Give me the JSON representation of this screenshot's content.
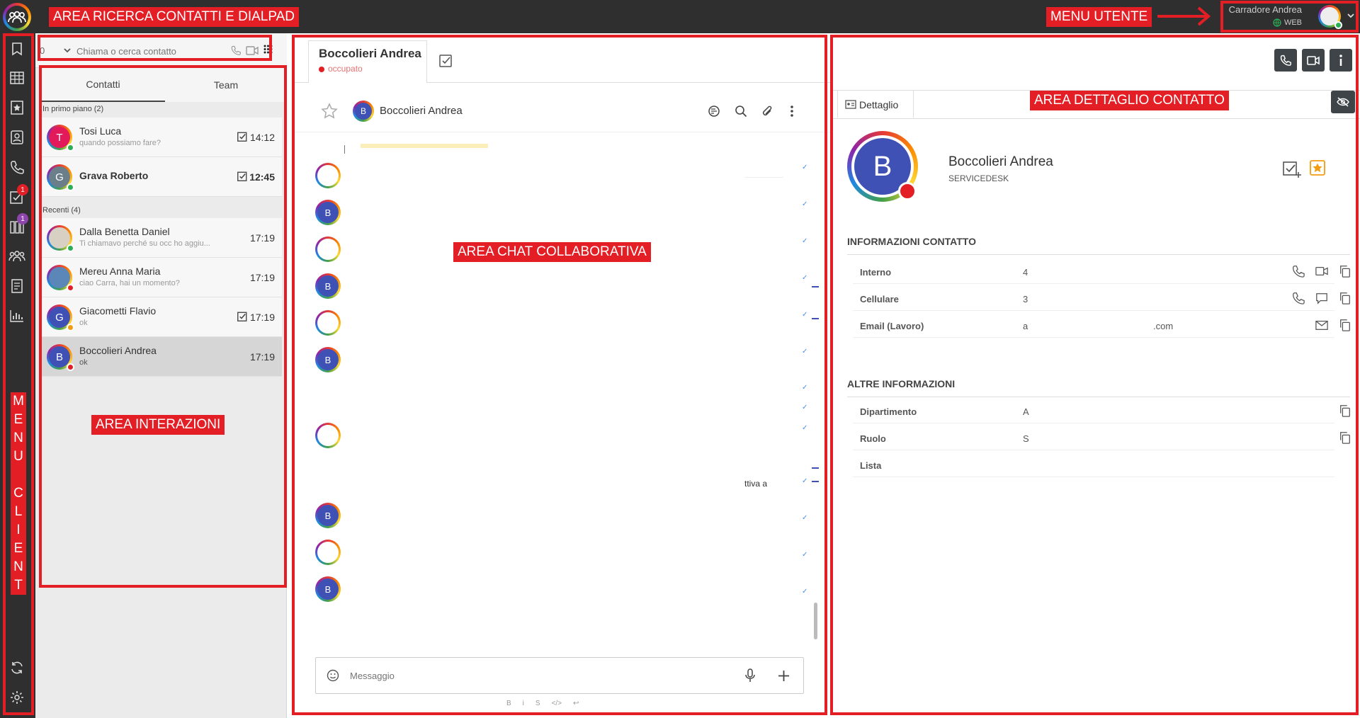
{
  "annotations": {
    "search_area": "AREA RICERCA CONTATTI E DIALPAD",
    "user_menu": "MENU UTENTE",
    "interactions_area": "AREA INTERAZIONI",
    "chat_area": "AREA CHAT COLLABORATIVA",
    "detail_area": "AREA DETTAGLIO CONTATTO",
    "menu_client": [
      "M",
      "E",
      "N",
      "U",
      " ",
      "C",
      "L",
      "I",
      "E",
      "N",
      "T"
    ]
  },
  "user": {
    "name": "Carradore Andrea",
    "status": "WEB"
  },
  "sidebar": {
    "icons": [
      "bookmark-icon",
      "grid-icon",
      "star-page-icon",
      "contacts-icon",
      "phone-icon",
      "tasks-icon",
      "board-icon",
      "team-icon",
      "notebook-icon",
      "stats-icon",
      "sync-icon",
      "settings-icon"
    ],
    "tasks_badge": "1",
    "board_badge": "1"
  },
  "search": {
    "prefix": "0",
    "placeholder": "Chiama o cerca contatto"
  },
  "tabs": {
    "contacts": "Contatti",
    "team": "Team"
  },
  "sections": {
    "pinned": "In primo piano (2)",
    "recent": "Recenti (4)"
  },
  "contacts": [
    {
      "initial": "T",
      "name": "Tosi Luca",
      "msg": "quando possiamo fare?",
      "time": "14:12",
      "color": "#e2195a",
      "status": "#2cae55",
      "bold": false,
      "check": true
    },
    {
      "initial": "G",
      "name": "Grava Roberto",
      "msg": "",
      "time": "12:45",
      "color": "#6b7f8a",
      "status": "#2cae55",
      "bold": true,
      "check": true
    },
    {
      "initial": "",
      "name": "Dalla Benetta Daniel",
      "msg": "Ti chiamavo perché su occ ho aggiu...",
      "time": "17:19",
      "color": "#d9d0c4",
      "status": "#2cae55",
      "bold": false,
      "check": false
    },
    {
      "initial": "",
      "name": "Mereu Anna Maria",
      "msg": "ciao Carra, hai un momento?",
      "time": "17:19",
      "color": "#5a86b8",
      "status": "#e31e24",
      "bold": false,
      "check": false
    },
    {
      "initial": "G",
      "name": "Giacometti Flavio",
      "msg": "ok",
      "time": "17:19",
      "color": "#3f51b5",
      "status": "#f39c12",
      "bold": false,
      "check": true
    },
    {
      "initial": "B",
      "name": "Boccolieri Andrea",
      "msg": "ok",
      "time": "17:19",
      "color": "#3f51b5",
      "status": "#e31e24",
      "bold": false,
      "check": false,
      "selected": true
    }
  ],
  "chat": {
    "tab_name": "Boccolieri Andrea",
    "tab_status": "occupato",
    "header_name": "Boccolieri Andrea",
    "header_initial": "B",
    "snippet": "ttiva a",
    "composer_placeholder": "Messaggio",
    "format_bar": [
      "B",
      "i",
      "S",
      "</>",
      "↩"
    ]
  },
  "detail": {
    "tab": "Dettaglio",
    "initial": "B",
    "name": "Boccolieri Andrea",
    "dept": "SERVICEDESK",
    "info_title": "INFORMAZIONI CONTATTO",
    "info_rows": [
      {
        "label": "Interno",
        "value": "4"
      },
      {
        "label": "Cellulare",
        "value": "3"
      },
      {
        "label": "Email (Lavoro)",
        "value": "a",
        "suffix": ".com"
      }
    ],
    "other_title": "ALTRE INFORMAZIONI",
    "other_rows": [
      {
        "label": "Dipartimento",
        "value": "A"
      },
      {
        "label": "Ruolo",
        "value": "S"
      },
      {
        "label": "Lista",
        "value": ""
      }
    ]
  }
}
